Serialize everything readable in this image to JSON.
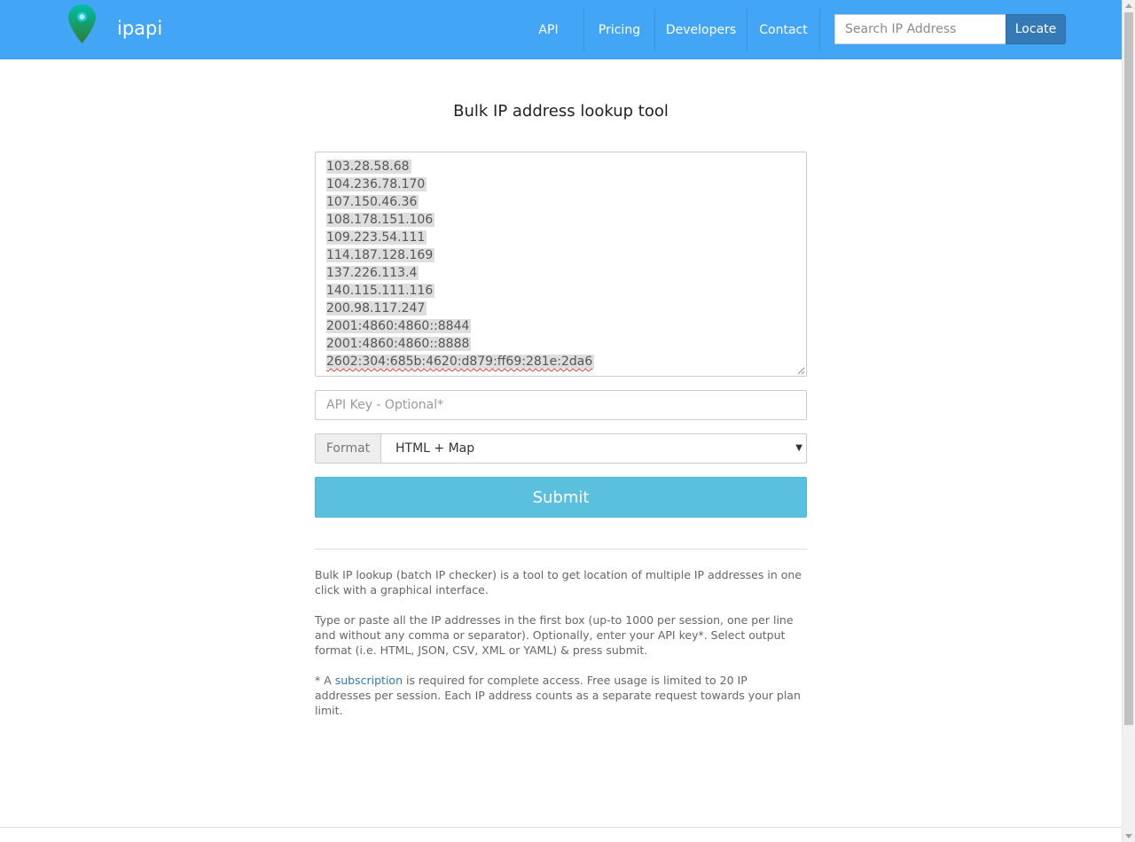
{
  "header": {
    "brand": "ipapi",
    "logo_icon": "map-pin-icon",
    "nav": {
      "api": "API",
      "pricing": "Pricing",
      "developers": "Developers",
      "contact": "Contact"
    },
    "search": {
      "placeholder": "Search IP Address",
      "value": ""
    },
    "locate_label": "Locate"
  },
  "main": {
    "title": "Bulk IP address lookup tool",
    "ip_list": [
      "103.28.58.68",
      "104.236.78.170",
      "107.150.46.36",
      "108.178.151.106",
      "109.223.54.111",
      "114.187.128.169",
      "137.226.113.4",
      "140.115.111.116",
      "200.98.117.247",
      "2001:4860:4860::8844",
      "2001:4860:4860::8888",
      "2602:304:685b:4620:d879:ff69:281e:2da6"
    ],
    "api_key": {
      "placeholder": "API Key - Optional*",
      "value": ""
    },
    "format": {
      "label": "Format",
      "selected": "HTML + Map"
    },
    "submit_label": "Submit",
    "description": {
      "p1": "Bulk IP lookup (batch IP checker) is a tool to get location of multiple IP addresses in one click with a graphical interface.",
      "p2": "Type or paste all the IP addresses in the first box (up-to 1000 per session, one per line and without any comma or separator). Optionally, enter your API key*. Select output format (i.e. HTML, JSON, CSV, XML or YAML) & press submit.",
      "p3_prefix": "* A ",
      "p3_link": "subscription",
      "p3_suffix": " is required for complete access. Free usage is limited to 20 IP addresses per session. Each IP address counts as a separate request towards your plan limit."
    }
  },
  "colors": {
    "navbar": "#42a5f5",
    "locate_button": "#337ab7",
    "submit_button": "#5bc0de",
    "link": "#337ab7"
  }
}
